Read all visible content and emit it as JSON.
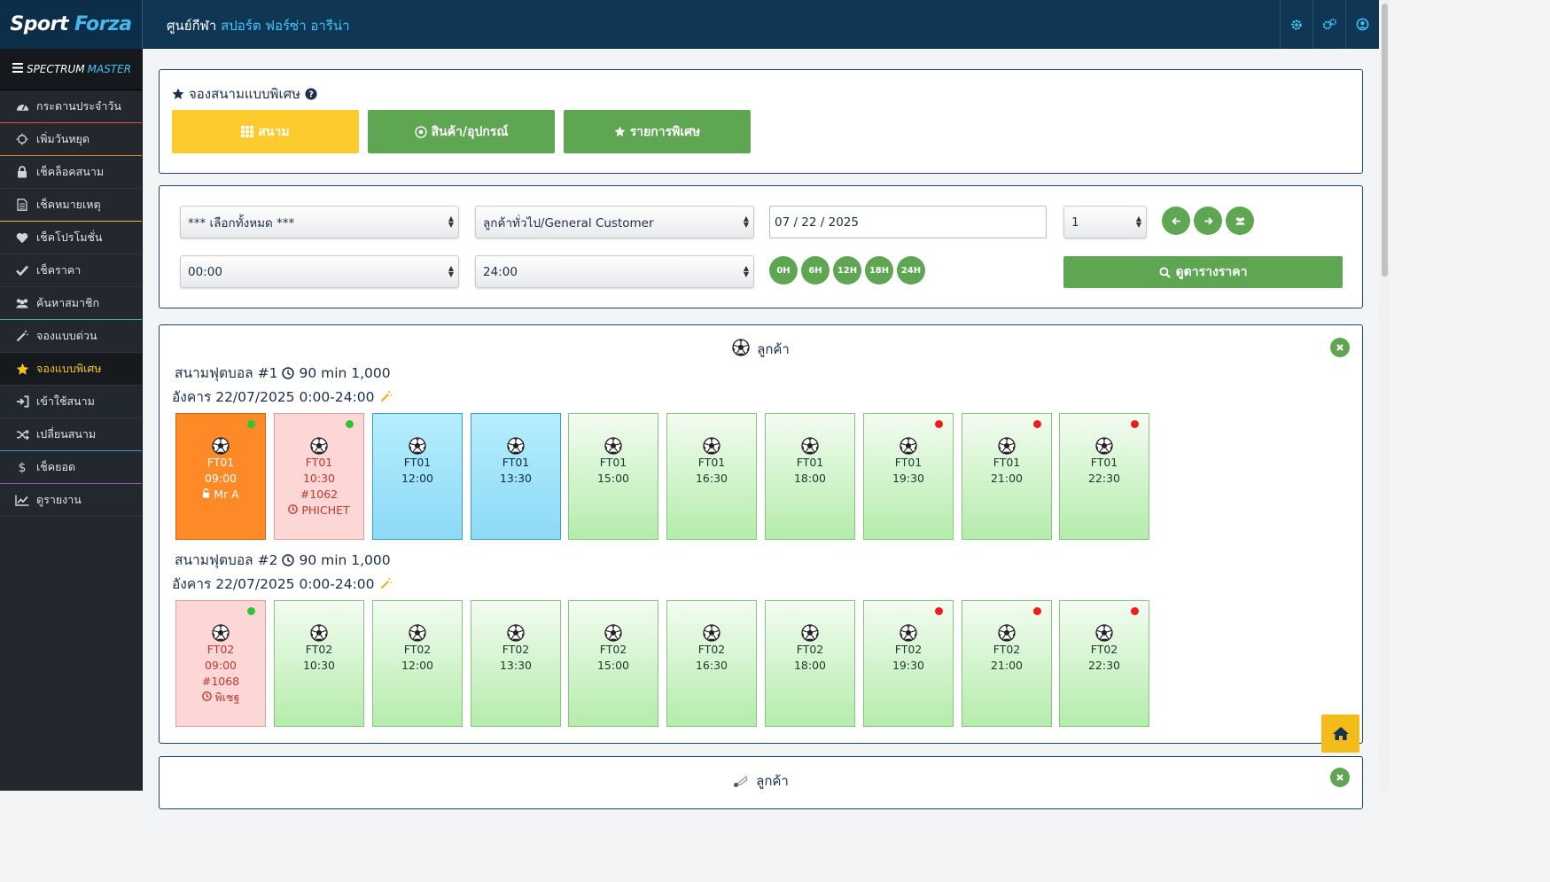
{
  "brand": {
    "part1": "Sport ",
    "part2": "Forza"
  },
  "header": {
    "venue_prefix": "ศูนย์กีฬา",
    "venue_name": "สปอร์ต ฟอร์ซ่า อารีน่า"
  },
  "sidebar": {
    "master_part1": "SPECTRUM",
    "master_part2": "MASTER",
    "items": [
      {
        "label": "กระดานประจำวัน",
        "icon": "dashboard-icon",
        "color": "#e74c3c"
      },
      {
        "label": "เพิ่มวันหยุด",
        "icon": "sun-icon",
        "color": "#e67e22"
      },
      {
        "label": "เช็คล็อคสนาม",
        "icon": "lock-icon",
        "color": "#333333"
      },
      {
        "label": "เช็คหมายเหตุ",
        "icon": "note-icon",
        "color": "#f1c40f"
      },
      {
        "label": "เช็คโปรโมชั่น",
        "icon": "heart-icon",
        "color": "#333333"
      },
      {
        "label": "เช็คราคา",
        "icon": "check-icon",
        "color": "#333333"
      },
      {
        "label": "ค้นหาสมาชิก",
        "icon": "users-icon",
        "color": "#2ecc71"
      },
      {
        "label": "จองแบบด่วน",
        "icon": "wand-icon",
        "color": "#333333"
      },
      {
        "label": "จองแบบพิเศษ",
        "icon": "star-icon",
        "color": "#333333"
      },
      {
        "label": "เข้าใช้สนาม",
        "icon": "sign-in-icon",
        "color": "#333333"
      },
      {
        "label": "เปลี่ยนสนาม",
        "icon": "shuffle-icon",
        "color": "#3498db"
      },
      {
        "label": "เช็คยอด",
        "icon": "dollar-icon",
        "color": "#9b59b6"
      },
      {
        "label": "ดูรายงาน",
        "icon": "chart-line-icon",
        "color": "#333333"
      }
    ]
  },
  "special": {
    "title": "จองสนามแบบพิเศษ",
    "buttons": [
      {
        "label": "สนาม",
        "color": "#fecb2e"
      },
      {
        "label": "สินค้า/อุปกรณ์",
        "color": "#5fa653"
      },
      {
        "label": "รายการพิเศษ",
        "color": "#5fa653"
      }
    ]
  },
  "filters": {
    "field_select": "*** เลือกทั้งหมด ***",
    "customer_select": "ลูกค้าทั่วไป/General Customer",
    "date": "07 / 22 / 2025",
    "count_select": "1",
    "start_time": "00:00",
    "end_time": "24:00",
    "hour_buttons": [
      "0H",
      "6H",
      "12H",
      "18H",
      "24H"
    ],
    "search_label": "ดูตารางราคา"
  },
  "booking": {
    "section_label": "ลูกค้า",
    "section2_label": "ลูกค้า",
    "fields": [
      {
        "title": "สนามฟุตบอล #1",
        "duration": "90 min 1,000",
        "date_range": "อังคาร 22/07/2025 0:00-24:00",
        "slots": [
          {
            "code": "FT01",
            "time": "09:00",
            "booking": "",
            "customer": "Mr A",
            "style": "orange",
            "dot": "green"
          },
          {
            "code": "FT01",
            "time": "10:30",
            "booking": "#1062",
            "customer": "PHICHET",
            "style": "pink",
            "dot": "green"
          },
          {
            "code": "FT01",
            "time": "12:00",
            "booking": "",
            "customer": "",
            "style": "blue",
            "dot": ""
          },
          {
            "code": "FT01",
            "time": "13:30",
            "booking": "",
            "customer": "",
            "style": "blue",
            "dot": ""
          },
          {
            "code": "FT01",
            "time": "15:00",
            "booking": "",
            "customer": "",
            "style": "green",
            "dot": ""
          },
          {
            "code": "FT01",
            "time": "16:30",
            "booking": "",
            "customer": "",
            "style": "green",
            "dot": ""
          },
          {
            "code": "FT01",
            "time": "18:00",
            "booking": "",
            "customer": "",
            "style": "green",
            "dot": ""
          },
          {
            "code": "FT01",
            "time": "19:30",
            "booking": "",
            "customer": "",
            "style": "green",
            "dot": "red"
          },
          {
            "code": "FT01",
            "time": "21:00",
            "booking": "",
            "customer": "",
            "style": "green",
            "dot": "red"
          },
          {
            "code": "FT01",
            "time": "22:30",
            "booking": "",
            "customer": "",
            "style": "green",
            "dot": "red"
          }
        ]
      },
      {
        "title": "สนามฟุตบอล #2",
        "duration": "90 min 1,000",
        "date_range": "อังคาร 22/07/2025 0:00-24:00",
        "slots": [
          {
            "code": "FT02",
            "time": "09:00",
            "booking": "#1068",
            "customer": "พิเชฐ",
            "style": "pink",
            "dot": "green"
          },
          {
            "code": "FT02",
            "time": "10:30",
            "booking": "",
            "customer": "",
            "style": "green",
            "dot": ""
          },
          {
            "code": "FT02",
            "time": "12:00",
            "booking": "",
            "customer": "",
            "style": "green",
            "dot": ""
          },
          {
            "code": "FT02",
            "time": "13:30",
            "booking": "",
            "customer": "",
            "style": "green",
            "dot": ""
          },
          {
            "code": "FT02",
            "time": "15:00",
            "booking": "",
            "customer": "",
            "style": "green",
            "dot": ""
          },
          {
            "code": "FT02",
            "time": "16:30",
            "booking": "",
            "customer": "",
            "style": "green",
            "dot": ""
          },
          {
            "code": "FT02",
            "time": "18:00",
            "booking": "",
            "customer": "",
            "style": "green",
            "dot": ""
          },
          {
            "code": "FT02",
            "time": "19:30",
            "booking": "",
            "customer": "",
            "style": "green",
            "dot": "red"
          },
          {
            "code": "FT02",
            "time": "21:00",
            "booking": "",
            "customer": "",
            "style": "green",
            "dot": "red"
          },
          {
            "code": "FT02",
            "time": "22:30",
            "booking": "",
            "customer": "",
            "style": "green",
            "dot": "red"
          }
        ]
      }
    ]
  }
}
